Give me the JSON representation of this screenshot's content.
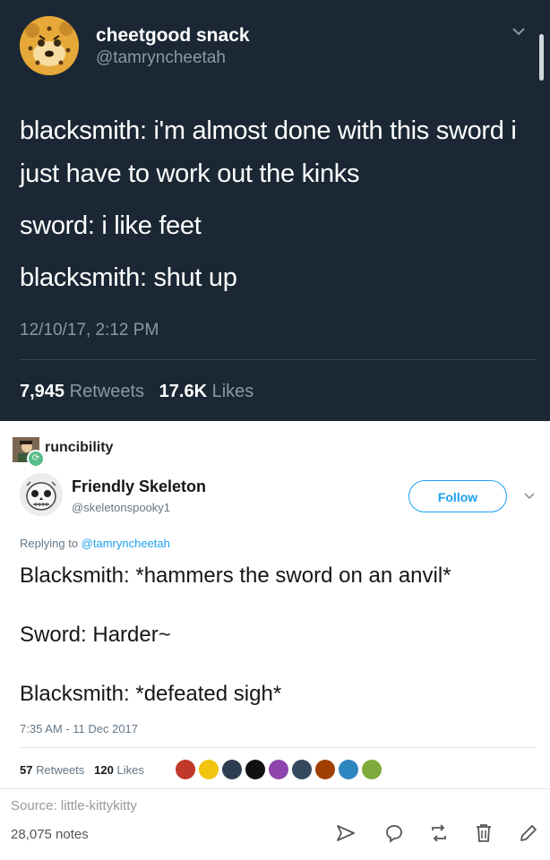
{
  "tweet1": {
    "display_name": "cheetgood snack",
    "handle": "@tamryncheetah",
    "lines": [
      "blacksmith: i'm almost done with this sword i just have to work out the kinks",
      "sword: i like feet",
      "blacksmith: shut up"
    ],
    "timestamp": "12/10/17, 2:12 PM",
    "retweet_count": "7,945",
    "retweet_label": "Retweets",
    "like_count": "17.6K",
    "like_label": "Likes",
    "colors": {
      "background": "#1b2734",
      "secondary_text": "#8899a6"
    }
  },
  "reblogger": {
    "name": "runcibility",
    "badge_icon": "reblog-icon"
  },
  "tweet2": {
    "display_name": "Friendly Skeleton",
    "handle": "@skeletonspooky1",
    "follow_label": "Follow",
    "replying_prefix": "Replying to",
    "replying_to": "@tamryncheetah",
    "lines": [
      "Blacksmith: *hammers the sword on an anvil*",
      "Sword: Harder~",
      "Blacksmith: *defeated sigh*"
    ],
    "timestamp": "7:35 AM - 11 Dec 2017",
    "retweet_count": "57",
    "retweet_label": "Retweets",
    "like_count": "120",
    "like_label": "Likes",
    "colors": {
      "accent": "#1da1f2"
    }
  },
  "footer": {
    "source": "Source: little-kittykitty",
    "notes": "28,075 notes",
    "actions": [
      "share-icon",
      "reply-icon",
      "reblog-icon",
      "delete-icon",
      "edit-icon"
    ]
  }
}
